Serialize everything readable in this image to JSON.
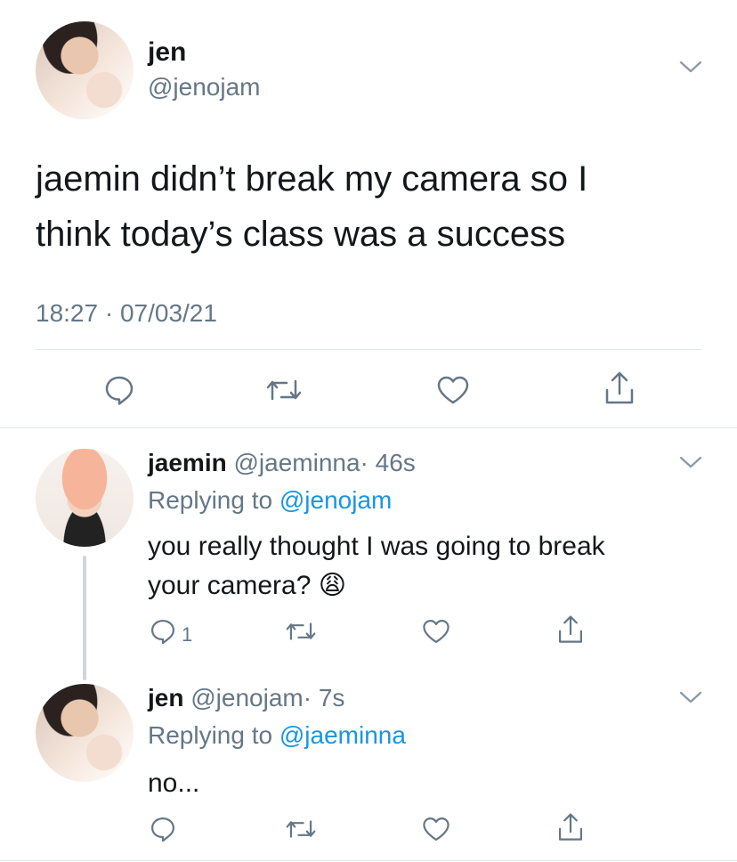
{
  "main_tweet": {
    "name": "jen",
    "handle": "@jenojam",
    "text_line1": "jaemin didn’t break my camera so I",
    "text_line2": "think today’s class was a success",
    "timestamp": "18:27 · 07/03/21",
    "actions": [
      "reply-icon",
      "retweet-icon",
      "like-icon",
      "share-icon"
    ]
  },
  "replies": [
    {
      "name": "jaemin",
      "handle": "@jaeminna",
      "time": "· 46s",
      "replying_label": "Replying to",
      "replying_to": "@jenojam",
      "text_line1": "you really thought I was going to break",
      "text_line2": "your camera? 😩",
      "reply_count": "1"
    },
    {
      "name": "jen",
      "handle": "@jenojam",
      "time": "· 7s",
      "replying_label": "Replying to",
      "replying_to": "@jaeminna",
      "text_line1": "no..."
    }
  ],
  "colors": {
    "text": "#14171a",
    "secondary": "#657786",
    "link": "#1b95e0",
    "divider": "#e1e8ed"
  }
}
